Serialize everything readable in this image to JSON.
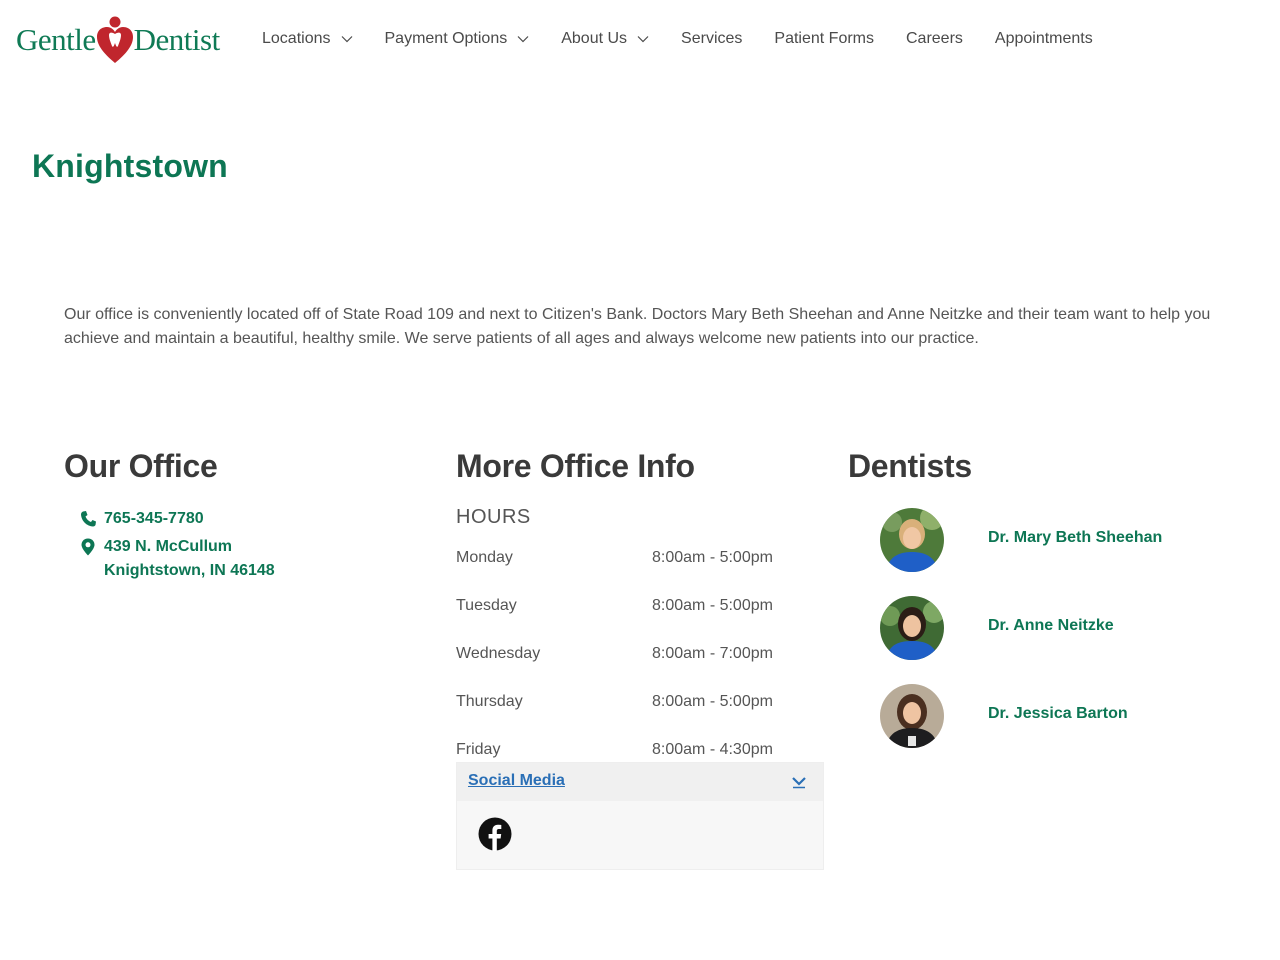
{
  "brand": {
    "logo_left": "Gentle",
    "logo_right": "Dentist",
    "green": "#0d7654",
    "red": "#c0262d"
  },
  "nav": {
    "items": [
      {
        "label": "Locations",
        "dropdown": true
      },
      {
        "label": "Payment Options",
        "dropdown": true
      },
      {
        "label": "About Us",
        "dropdown": true
      },
      {
        "label": "Services",
        "dropdown": false
      },
      {
        "label": "Patient Forms",
        "dropdown": false
      },
      {
        "label": "Careers",
        "dropdown": false
      },
      {
        "label": "Appointments",
        "dropdown": false
      }
    ]
  },
  "page": {
    "title": "Knightstown",
    "intro": "Our office is conveniently located off of State Road 109 and next to Citizen's Bank. Doctors Mary Beth Sheehan and Anne Neitzke and their team want to help you achieve and maintain a beautiful, healthy smile. We serve patients of all ages and always welcome new patients into our practice."
  },
  "office": {
    "title": "Our Office",
    "phone": "765-345-7780",
    "address_line1": "439 N. McCullum",
    "address_line2": "Knightstown, IN 46148",
    "phone_icon": "phone-icon",
    "location_icon": "map-pin-icon"
  },
  "info": {
    "title": "More Office Info",
    "hours_title": "HOURS",
    "hours": [
      {
        "day": "Monday",
        "time": "8:00am - 5:00pm"
      },
      {
        "day": "Tuesday",
        "time": "8:00am - 5:00pm"
      },
      {
        "day": "Wednesday",
        "time": "8:00am - 7:00pm"
      },
      {
        "day": "Thursday",
        "time": "8:00am - 5:00pm"
      },
      {
        "day": "Friday",
        "time": "8:00am - 4:30pm"
      }
    ],
    "social_title": "Social Media",
    "social_icon": "facebook-icon"
  },
  "dentists": {
    "title": "Dentists",
    "list": [
      {
        "name": "Dr. Mary Beth Sheehan"
      },
      {
        "name": "Dr. Anne Neitzke"
      },
      {
        "name": "Dr. Jessica Barton"
      }
    ]
  }
}
